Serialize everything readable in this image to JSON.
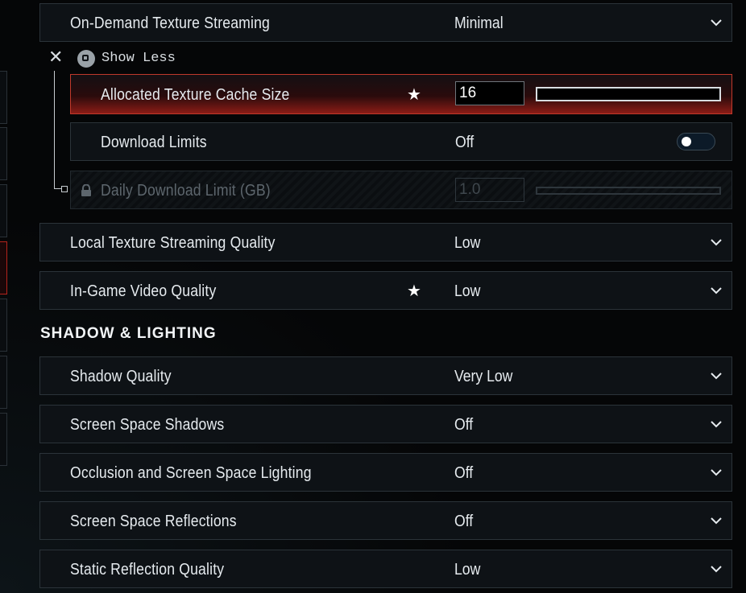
{
  "graphics": {
    "on_demand_streaming": {
      "label": "On-Demand Texture Streaming",
      "value": "Minimal"
    },
    "show_less": {
      "close": "✕",
      "label": "Show Less"
    },
    "texture_cache": {
      "label": "Allocated Texture Cache Size",
      "value": "16",
      "starred": "★",
      "slider_fraction": 0.0
    },
    "download_limits": {
      "label": "Download Limits",
      "value": "Off",
      "toggle_on": false
    },
    "daily_limit": {
      "label": "Daily Download Limit (GB)",
      "value": "1.0",
      "locked": true
    },
    "local_streaming": {
      "label": "Local Texture Streaming Quality",
      "value": "Low"
    },
    "video_quality": {
      "label": "In-Game Video Quality",
      "value": "Low",
      "starred": "★"
    }
  },
  "shadow_section": {
    "title": "SHADOW & LIGHTING",
    "rows": [
      {
        "label": "Shadow Quality",
        "value": "Very Low"
      },
      {
        "label": "Screen Space Shadows",
        "value": "Off"
      },
      {
        "label": "Occlusion and Screen Space Lighting",
        "value": "Off"
      },
      {
        "label": "Screen Space Reflections",
        "value": "Off"
      },
      {
        "label": "Static Reflection Quality",
        "value": "Low"
      }
    ]
  },
  "colors": {
    "accent": "#c0392b",
    "row_bg": "#0e1216",
    "border": "#2b3339",
    "text": "#e6ebef"
  },
  "icons": {
    "dropdown": "chevron-down-icon",
    "lock": "lock-icon",
    "star": "star-icon",
    "close": "close-icon"
  }
}
